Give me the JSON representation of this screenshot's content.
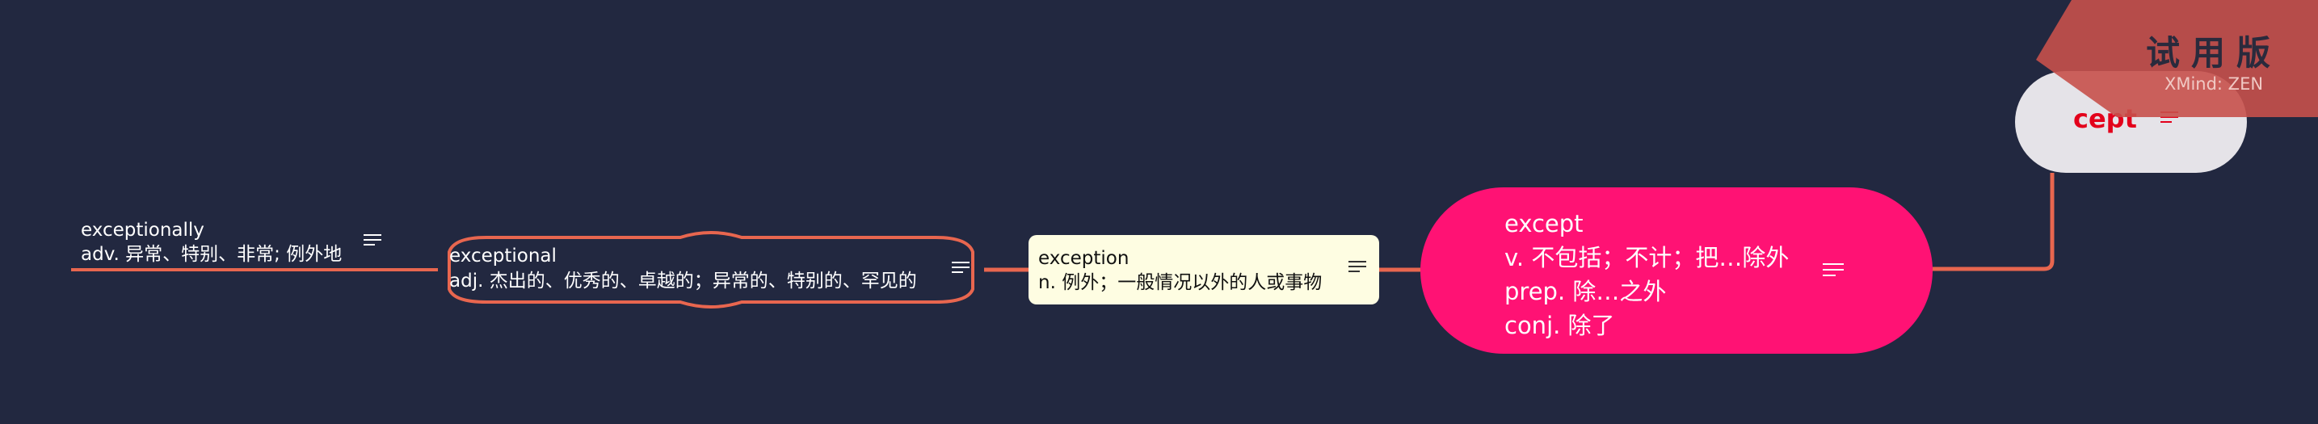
{
  "colors": {
    "background": "#222840",
    "connector": "#e8664f",
    "root_fill": "#e5e3e8",
    "root_text": "#e3001b",
    "except_fill": "#ff1274",
    "exception_fill": "#fefde2",
    "exceptional_border": "#e8664f",
    "ribbon": "#c6504b"
  },
  "icons": {
    "note": "note-lines-icon"
  },
  "nodes": {
    "cept": {
      "text": "cept",
      "has_note": true
    },
    "except": {
      "text": "except\nv. 不包括；不计；把…除外\nprep. 除…之外\nconj. 除了",
      "has_note": true
    },
    "exception": {
      "text": "exception\nn. 例外；一般情况以外的人或事物",
      "has_note": true
    },
    "exceptional": {
      "text": "exceptional\nadj. 杰出的、优秀的、卓越的；异常的、特别的、罕见的",
      "has_note": true
    },
    "exceptionally": {
      "text": "exceptionally\nadv. 异常、特别、非常; 例外地",
      "has_note": true
    }
  },
  "watermark": {
    "title": "试用版",
    "subtitle": "XMind: ZEN"
  }
}
